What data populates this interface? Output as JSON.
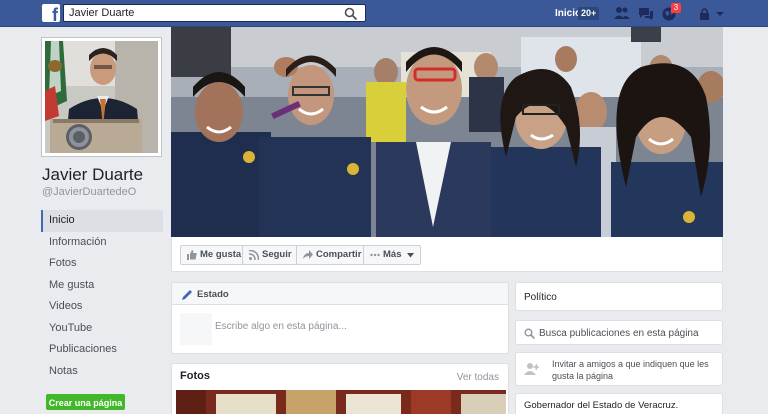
{
  "topbar": {
    "search_value": "Javier Duarte",
    "home_label": "Inicio",
    "home_count": "20+",
    "notifications_count": "3",
    "colors": {
      "bar": "#3b5998",
      "badge": "#fa3e3e"
    }
  },
  "profile": {
    "name": "Javier Duarte",
    "handle": "@JavierDuartedeO"
  },
  "left_nav": {
    "items": [
      {
        "label": "Inicio",
        "active": true
      },
      {
        "label": "Información"
      },
      {
        "label": "Fotos"
      },
      {
        "label": "Me gusta"
      },
      {
        "label": "Videos"
      },
      {
        "label": "YouTube"
      },
      {
        "label": "Publicaciones"
      },
      {
        "label": "Notas"
      }
    ],
    "create_page_label": "Crear una página"
  },
  "actions": {
    "like": "Me gusta",
    "follow": "Seguir",
    "share": "Compartir",
    "more": "Más"
  },
  "composer": {
    "title": "Estado",
    "placeholder": "Escribe algo en esta página..."
  },
  "photos": {
    "title": "Fotos",
    "see_all": "Ver todas"
  },
  "sidebar": {
    "category": "Político",
    "search_posts": "Busca publicaciones en esta página",
    "invite_text": "Invitar a amigos a que indiquen que les gusta la página",
    "about": "Gobernador del Estado de Veracruz."
  }
}
